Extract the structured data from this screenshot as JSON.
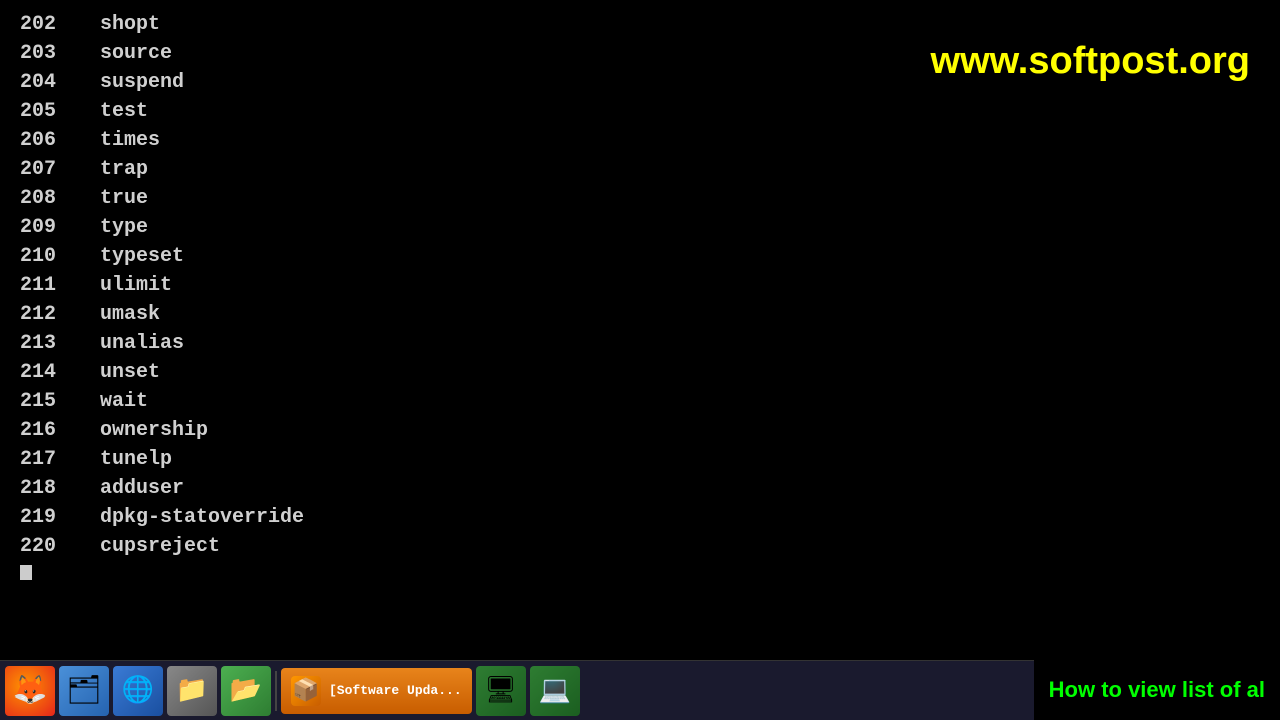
{
  "watermark": {
    "url": "www.softpost.org"
  },
  "terminal": {
    "lines": [
      {
        "num": "202",
        "cmd": "shopt"
      },
      {
        "num": "203",
        "cmd": "source"
      },
      {
        "num": "204",
        "cmd": "suspend"
      },
      {
        "num": "205",
        "cmd": "test"
      },
      {
        "num": "206",
        "cmd": "times"
      },
      {
        "num": "207",
        "cmd": "trap"
      },
      {
        "num": "208",
        "cmd": "true"
      },
      {
        "num": "209",
        "cmd": "type"
      },
      {
        "num": "210",
        "cmd": "typeset"
      },
      {
        "num": "211",
        "cmd": "ulimit"
      },
      {
        "num": "212",
        "cmd": "umask"
      },
      {
        "num": "213",
        "cmd": "unalias"
      },
      {
        "num": "214",
        "cmd": "unset"
      },
      {
        "num": "215",
        "cmd": "wait"
      },
      {
        "num": "216",
        "cmd": "ownership"
      },
      {
        "num": "217",
        "cmd": "tunelp"
      },
      {
        "num": "218",
        "cmd": "adduser"
      },
      {
        "num": "219",
        "cmd": "dpkg-statoverride"
      },
      {
        "num": "220",
        "cmd": "cupsreject"
      }
    ]
  },
  "taskbar": {
    "app_button_label": "[Software Upda...",
    "tip_text": "How to view list of al"
  }
}
